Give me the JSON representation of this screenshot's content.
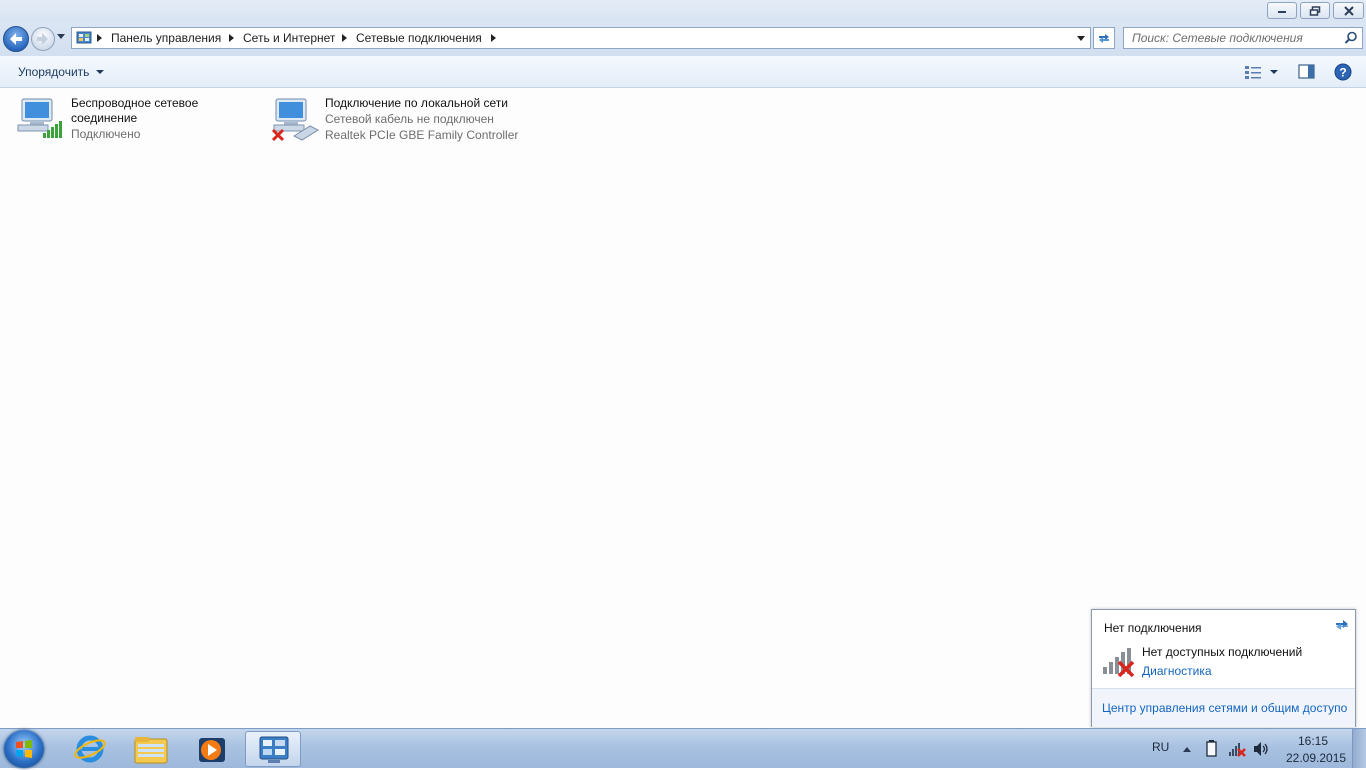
{
  "window": {
    "breadcrumbs": [
      "Панель управления",
      "Сеть и Интернет",
      "Сетевые подключения"
    ],
    "search_placeholder": "Поиск: Сетевые подключения"
  },
  "toolbar": {
    "organize_label": "Упорядочить"
  },
  "connections": [
    {
      "name_line1": "Беспроводное сетевое",
      "name_line2": "соединение",
      "status": "Подключено",
      "icon": "wireless-network-icon"
    },
    {
      "name_line1": "Подключение по локальной сети",
      "status": "Сетевой кабель не подключен",
      "adapter": "Realtek PCIe GBE Family Controller",
      "icon": "ethernet-network-icon"
    }
  ],
  "flyout": {
    "title": "Нет подключения",
    "no_connections": "Нет доступных подключений",
    "diagnostics_link": "Диагностика",
    "network_center_link": "Центр управления сетями и общим доступо"
  },
  "taskbar": {
    "language": "RU",
    "time": "16:15",
    "date": "22.09.2015"
  },
  "colors": {
    "link": "#1565c0",
    "status_gray": "#6d6d6d",
    "signal_green": "#3aa33a",
    "error_red": "#d9261c"
  }
}
